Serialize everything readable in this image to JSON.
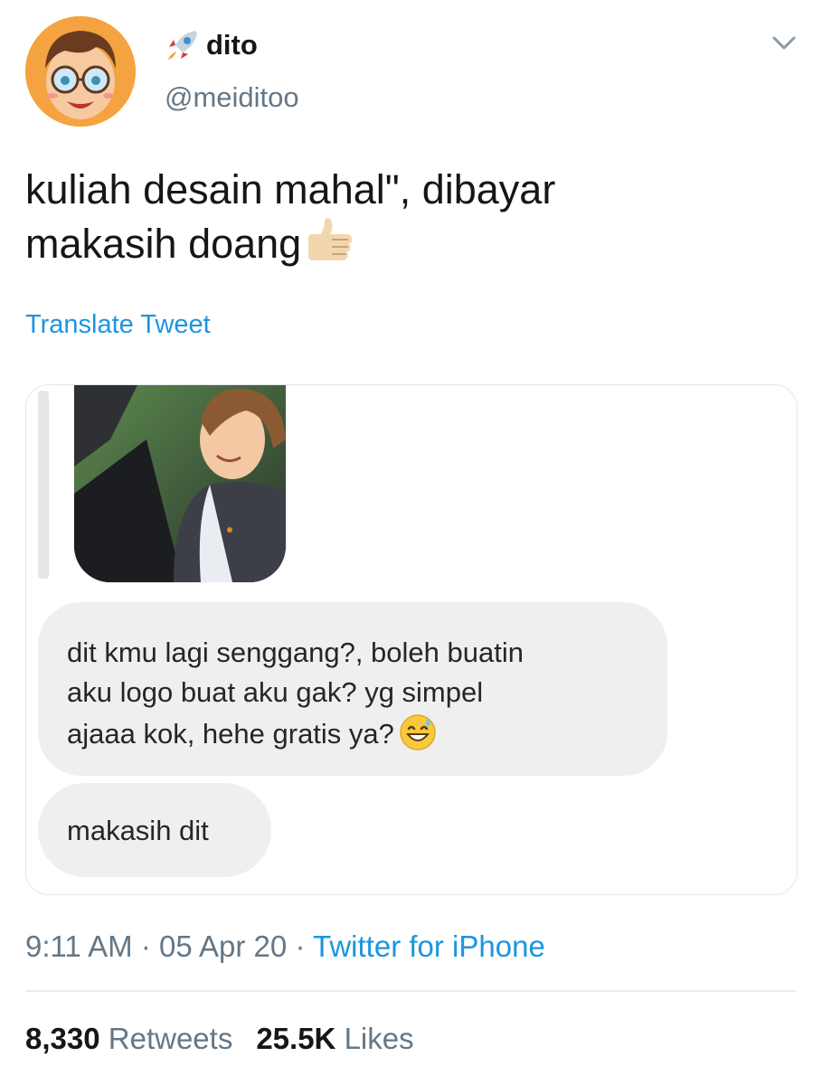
{
  "author": {
    "display_name": "dito",
    "handle": "@meiditoo",
    "avatar_icon": "cartoon-avatar-icon",
    "badge_icon": "rocket-emoji-icon"
  },
  "tweet": {
    "text_line_1": "kuliah desain mahal\", dibayar",
    "text_line_2": "makasih doang",
    "trailing_emoji": "thumbs-up-emoji-icon",
    "translate_label": "Translate Tweet"
  },
  "chat": {
    "messages": [
      {
        "lines": [
          "dit kmu lagi senggang?, boleh buatin",
          "aku logo buat aku gak? yg simpel",
          "ajaaa kok, hehe gratis ya?"
        ],
        "emoji": "grinning-sweat-emoji-icon"
      },
      {
        "lines": [
          "makasih dit"
        ]
      }
    ]
  },
  "meta": {
    "time": "9:11 AM",
    "separator": "·",
    "date": "05 Apr 20",
    "source": "Twitter for iPhone"
  },
  "stats": {
    "retweets_count": "8,330",
    "retweets_label": "Retweets",
    "likes_count": "25.5K",
    "likes_label": "Likes"
  },
  "colors": {
    "link_blue": "#1b95e0",
    "secondary_gray": "#657786",
    "bubble_gray": "#efefef"
  }
}
